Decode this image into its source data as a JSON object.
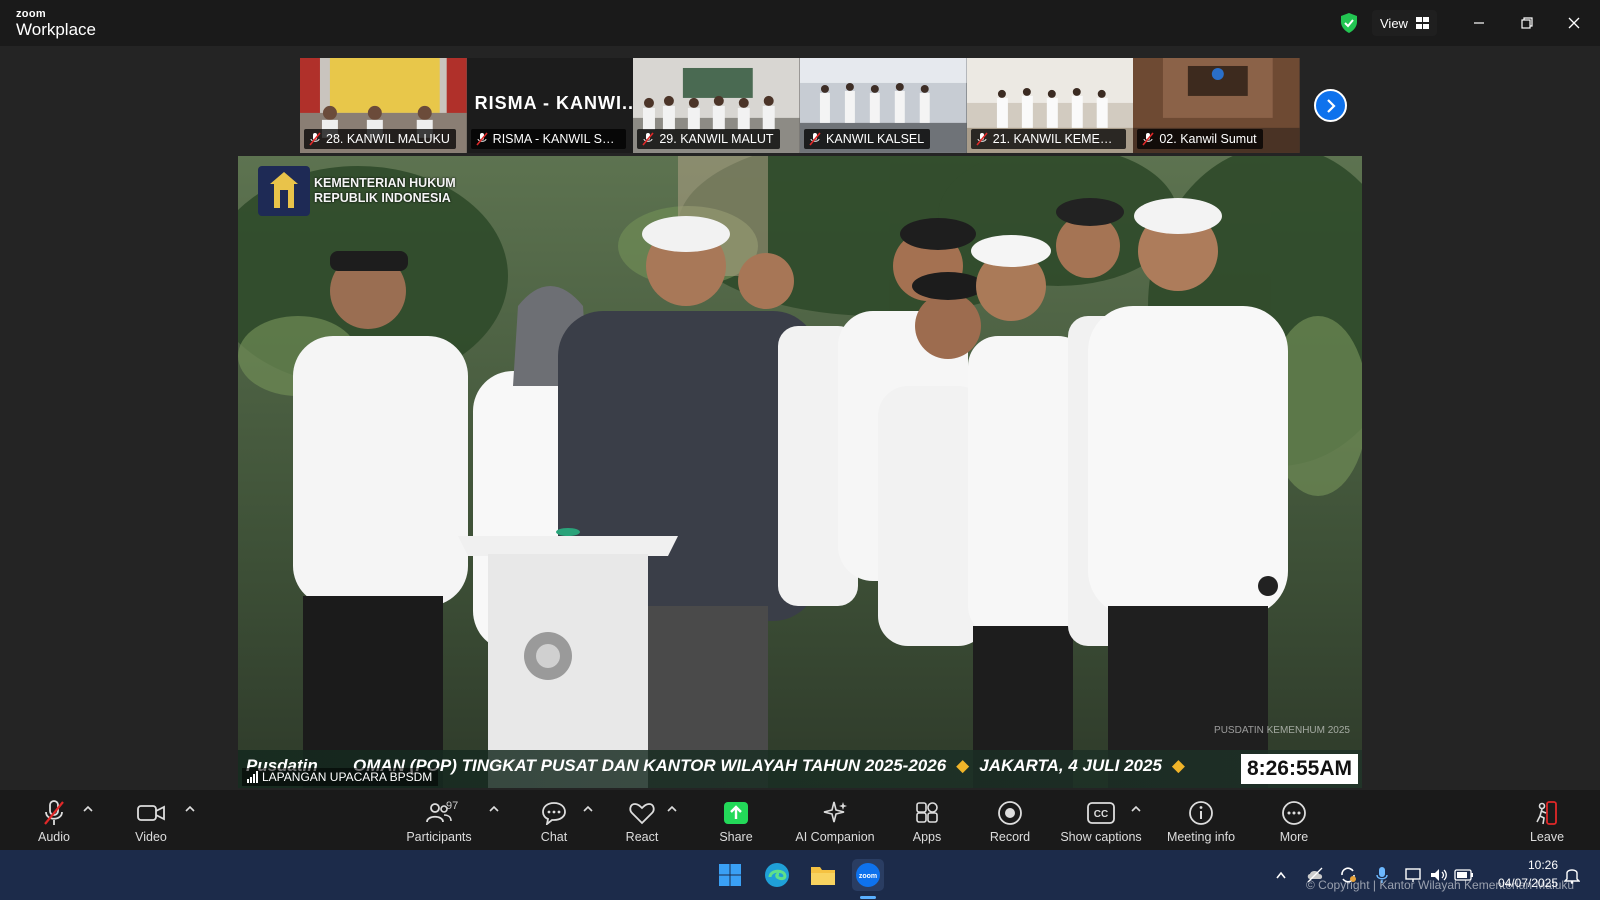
{
  "app": {
    "brand_small": "zoom",
    "brand_big": "Workplace"
  },
  "titlebar": {
    "view_label": "View"
  },
  "thumbnails": [
    {
      "label": "28. KANWIL MALUKU"
    },
    {
      "label": "RISMA - KANWIL SUL...",
      "big_name": "RISMA - KANWI..."
    },
    {
      "label": "29. KANWIL MALUT"
    },
    {
      "label": "KANWIL KALSEL"
    },
    {
      "label": "21. KANWIL KEMENTE..."
    },
    {
      "label": "02. Kanwil Sumut"
    }
  ],
  "main_video": {
    "ministry_line1": "KEMENTERIAN HUKUM",
    "ministry_line2": "REPUBLIK INDONESIA",
    "ticker_brand": "Pusdatin",
    "ticker_main": "OMAN (POP) TINGKAT PUSAT DAN KANTOR WILAYAH TAHUN 2025-2026",
    "ticker_place": "JAKARTA, 4 JULI 2025",
    "clock": "8:26:55AM",
    "venue": "LAPANGAN UPACARA BPSDM",
    "watermark": "PUSDATIN KEMENHUM 2025"
  },
  "toolbar": {
    "audio": "Audio",
    "video": "Video",
    "participants": "Participants",
    "participants_count": "97",
    "chat": "Chat",
    "react": "React",
    "share": "Share",
    "ai_companion": "AI Companion",
    "apps": "Apps",
    "record": "Record",
    "show_captions": "Show captions",
    "meeting_info": "Meeting info",
    "more": "More",
    "leave": "Leave"
  },
  "taskbar": {
    "time": "10:26",
    "date": "04/07/2025",
    "copyright": "© Copyright | Kantor Wilayah Kementerian Maluku"
  },
  "colors": {
    "accent": "#0e72ed",
    "share_green": "#23d959",
    "leave_red": "#e02828"
  }
}
